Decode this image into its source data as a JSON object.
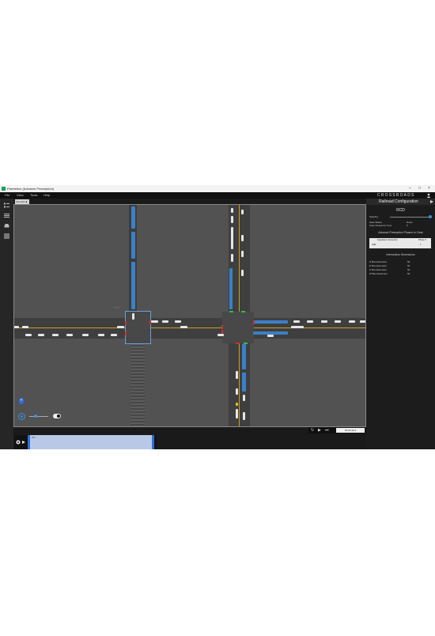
{
  "window": {
    "title": "Parmetion (Advance Preemption)",
    "controls": [
      "–",
      "□",
      "×"
    ]
  },
  "menu": {
    "items": [
      "File",
      "View",
      "Tools",
      "Help"
    ],
    "brand": "CROSSROADS"
  },
  "sidebar": {
    "icons": [
      "layers-icon",
      "list-icon",
      "vehicle-icon",
      "grid-icon"
    ]
  },
  "tabs": [
    {
      "label": "Scenario ■"
    }
  ],
  "viewport": {
    "zoom_label": "+",
    "rail_label": "— —"
  },
  "playback": {
    "controls": [
      "↻",
      "▶",
      "⏭"
    ],
    "time": "00:01:29.4"
  },
  "timeline": {
    "label": "0:0 ..."
  },
  "panel": {
    "header": "Railroad Configuration",
    "section": "RCD",
    "spacing_label": "Spacing",
    "spacing_value": 0.9,
    "gate_status_label": "Gate Status",
    "gate_status_value": "Down",
    "gate_clearance_label": "Gate Clearance Time",
    "gate_clearance_value": "5",
    "preemption_title": "Advance Preemption Phases to Clear",
    "preemption_table": {
      "headers": [
        "Signalized Intersection",
        "Phase #"
      ],
      "rows": [
        [
          "3NB",
          "1"
        ]
      ]
    },
    "dimensions_title": "Intersection Dimensions",
    "dimensions": [
      {
        "label": "N Bus Extension",
        "value": "50"
      },
      {
        "label": "E Bus Extension",
        "value": "50"
      },
      {
        "label": "S Bus Extension",
        "value": "50"
      },
      {
        "label": "W Bus Extension",
        "value": "50"
      }
    ]
  },
  "colors": {
    "accent": "#3d8fe0",
    "signal_red": "#d03030",
    "signal_green": "#30c050",
    "road_yellow": "#c9a020"
  }
}
